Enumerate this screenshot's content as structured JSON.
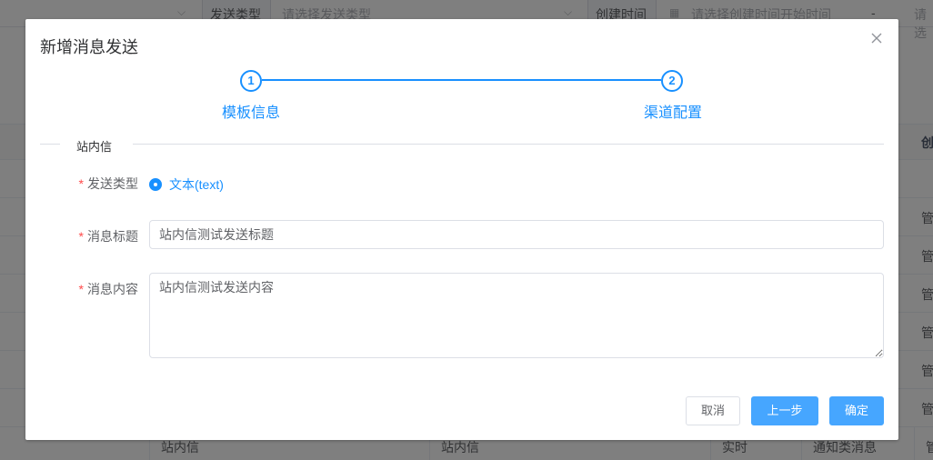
{
  "background": {
    "filter": {
      "send_type_label": "发送类型",
      "send_type_placeholder": "请选择发送类型",
      "create_time_label": "创建时间",
      "create_time_start_placeholder": "请选择创建时间开始时间",
      "range_separator": "-",
      "create_time_end_placeholder_partial": "请选"
    },
    "table": {
      "header_partial": "创",
      "row_partial": "管",
      "last_row": [
        "站内信",
        "站内信",
        "实时",
        "通知类消息",
        "管"
      ]
    }
  },
  "dialog": {
    "title": "新增消息发送",
    "close_icon": "close-icon",
    "steps": [
      {
        "number": "1",
        "title": "模板信息"
      },
      {
        "number": "2",
        "title": "渠道配置"
      }
    ],
    "section_divider": "站内信",
    "form": {
      "send_type": {
        "label": "发送类型",
        "required": true,
        "selected_option": "文本(text)"
      },
      "message_title": {
        "label": "消息标题",
        "required": true,
        "value": "站内信测试发送标题"
      },
      "message_content": {
        "label": "消息内容",
        "required": true,
        "value": "站内信测试发送内容"
      },
      "required_mark": "*"
    },
    "footer": {
      "cancel_label": "取消",
      "prev_label": "上一步",
      "confirm_label": "确定"
    }
  },
  "colors": {
    "primary": "#1890ff",
    "button_primary": "#46a6ff",
    "required": "#ff4949",
    "overlay": "rgba(0,0,0,0.5)"
  }
}
